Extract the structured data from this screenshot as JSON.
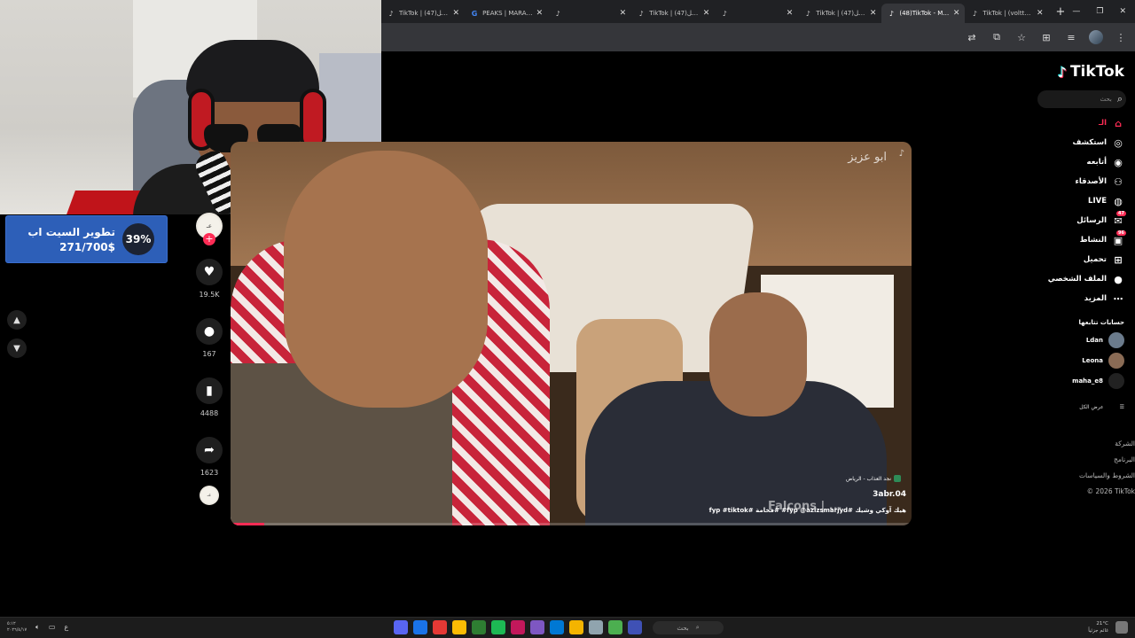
{
  "browser": {
    "tabs": [
      {
        "favicon": "tiktok-icon",
        "title": "TikTok | الرسائل(47)"
      },
      {
        "favicon": "google-icon",
        "title": "PEAKS | MARA - بحث Google"
      },
      {
        "favicon": "tiktok-icon",
        "title": ""
      },
      {
        "favicon": "tiktok-icon",
        "title": "TikTok | الرسائل(47)"
      },
      {
        "favicon": "tiktok-icon",
        "title": ""
      },
      {
        "favicon": "tiktok-icon",
        "title": "TikTok | الرسائل(47)"
      },
      {
        "favicon": "tiktok-icon",
        "title": "(48)TikTok - Make Your"
      },
      {
        "favicon": "tiktok-icon",
        "title": "TikTok | (volttzok7e@) ~(47)"
      }
    ],
    "new_tab": "+",
    "close_glyph": "✕"
  },
  "goal_widget": {
    "title": "تطوير السيت اب",
    "amount": "271/700$",
    "percent_label": "39%",
    "percent": 0.39,
    "color": "#2d5fb8"
  },
  "actions": {
    "likes": "19.5K",
    "comments": "167",
    "saves": "4488",
    "shares": "1623"
  },
  "video": {
    "watermark": "ابو عزيز",
    "music": "نجد العذاب - الرياض",
    "username": "3abr.04",
    "caption": "fyp #tiktok# فخامة# #fyp @azizsmarjyd# هيك آوكي وشيك",
    "overlay_text": "Falcons | ...",
    "progress": 0.05
  },
  "sidebar": {
    "logo": "TikTok",
    "search_placeholder": "بحث",
    "menu": [
      {
        "label": "الـ",
        "icon": "home-icon",
        "active": true
      },
      {
        "label": "استكشف",
        "icon": "compass-icon"
      },
      {
        "label": "أتابعه",
        "icon": "following-icon"
      },
      {
        "label": "الأصدقاء",
        "icon": "friends-icon"
      },
      {
        "label": "LIVE",
        "icon": "live-icon"
      },
      {
        "label": "الرسائل",
        "icon": "messages-icon",
        "badge": "47"
      },
      {
        "label": "النشاط",
        "icon": "activity-icon",
        "badge": "96"
      },
      {
        "label": "تحميل",
        "icon": "upload-icon"
      },
      {
        "label": "الملف الشخصي",
        "icon": "profile-icon"
      },
      {
        "label": "المزيد",
        "icon": "more-icon"
      }
    ],
    "following_header": "حسابات تتابعها",
    "following": [
      "Ldan",
      "Leona",
      "maha_e8"
    ],
    "see_all": "عرض الكل",
    "footer": [
      "الشركة",
      "البرنامج",
      "الشروط والسياسات",
      "© 2026 TikTok"
    ],
    "accent": "#fe2c55"
  },
  "taskbar": {
    "search": "بحث",
    "weather": "21°C",
    "weather_text": "غائم جزئياً"
  }
}
